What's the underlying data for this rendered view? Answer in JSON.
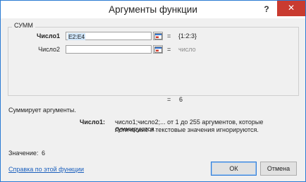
{
  "window": {
    "title": "Аргументы функции",
    "help_label": "?",
    "close_label": "✕"
  },
  "function": {
    "name": "СУММ"
  },
  "args": [
    {
      "label": "Число1",
      "value": "E2:E4",
      "result": "{1:2:3}"
    },
    {
      "label": "Число2",
      "value": "",
      "result": "число"
    }
  ],
  "formula_result": {
    "eq": "=",
    "value": "6"
  },
  "description": "Суммирует аргументы.",
  "arg_help": {
    "label": "Число1:",
    "line1": "число1;число2;... от 1 до 255 аргументов, которые суммируются.",
    "line2": "Логические и текстовые значения игнорируются."
  },
  "value_line": {
    "label": "Значение:",
    "value": "6"
  },
  "help_link": "Справка по этой функции",
  "buttons": {
    "ok": "ОК",
    "cancel": "Отмена"
  },
  "colors": {
    "accent": "#2b7bd3",
    "close": "#c93b30",
    "link": "#1a5fbd"
  },
  "icons": {
    "ref": "collapse-dialog-icon"
  }
}
